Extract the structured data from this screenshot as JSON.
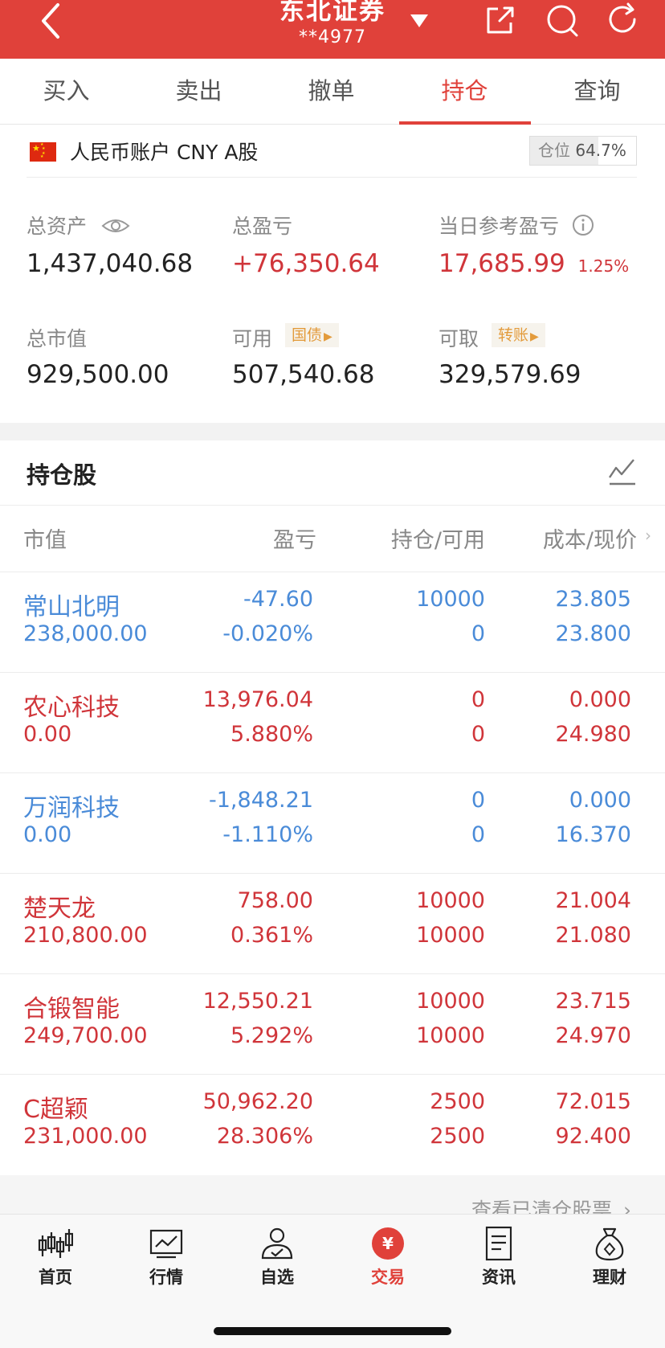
{
  "header": {
    "title": "东北证券",
    "account_masked": "**4977"
  },
  "tabs": [
    "买入",
    "卖出",
    "撤单",
    "持仓",
    "查询"
  ],
  "active_tab": "持仓",
  "account": {
    "label": "人民币账户 CNY A股",
    "position_label": "仓位",
    "position_ratio": "64.7%",
    "position_fill_fraction": 0.647
  },
  "summary": {
    "total_assets_label": "总资产",
    "total_assets": "1,437,040.68",
    "total_pnl_label": "总盈亏",
    "total_pnl": "+76,350.64",
    "daily_pnl_label": "当日参考盈亏",
    "daily_pnl": "17,685.99",
    "daily_pnl_pct": "1.25%",
    "market_value_label": "总市值",
    "market_value": "929,500.00",
    "available_label": "可用",
    "available_tag": "国债",
    "available": "507,540.68",
    "withdrawable_label": "可取",
    "withdrawable_tag": "转账",
    "withdrawable": "329,579.69"
  },
  "holdings": {
    "title": "持仓股",
    "columns": [
      "市值",
      "盈亏",
      "持仓/可用",
      "成本/现价"
    ],
    "rows": [
      {
        "name": "常山北明",
        "market_value": "238,000.00",
        "pnl": "-47.60",
        "pnl_pct": "-0.020%",
        "hold": "10000",
        "avail": "0",
        "cost": "23.805",
        "price": "23.800",
        "color": "#4a8bd8"
      },
      {
        "name": "农心科技",
        "market_value": "0.00",
        "pnl": "13,976.04",
        "pnl_pct": "5.880%",
        "hold": "0",
        "avail": "0",
        "cost": "0.000",
        "price": "24.980",
        "color": "#d0353a"
      },
      {
        "name": "万润科技",
        "market_value": "0.00",
        "pnl": "-1,848.21",
        "pnl_pct": "-1.110%",
        "hold": "0",
        "avail": "0",
        "cost": "0.000",
        "price": "16.370",
        "color": "#4a8bd8"
      },
      {
        "name": "楚天龙",
        "market_value": "210,800.00",
        "pnl": "758.00",
        "pnl_pct": "0.361%",
        "hold": "10000",
        "avail": "10000",
        "cost": "21.004",
        "price": "21.080",
        "color": "#d0353a"
      },
      {
        "name": "合锻智能",
        "market_value": "249,700.00",
        "pnl": "12,550.21",
        "pnl_pct": "5.292%",
        "hold": "10000",
        "avail": "10000",
        "cost": "23.715",
        "price": "24.970",
        "color": "#d0353a"
      },
      {
        "name": "C超颖",
        "market_value": "231,000.00",
        "pnl": "50,962.20",
        "pnl_pct": "28.306%",
        "hold": "2500",
        "avail": "2500",
        "cost": "72.015",
        "price": "92.400",
        "color": "#d0353a"
      }
    ],
    "more_label": "查看已清仓股票"
  },
  "bottom_nav": [
    "首页",
    "行情",
    "自选",
    "交易",
    "资讯",
    "理财"
  ],
  "active_nav": "交易",
  "colors": {
    "brand_red": "#e0413a",
    "gain_red": "#d0353a",
    "loss_blue": "#4a8bd8",
    "tag_orange": "#e39b3c"
  }
}
